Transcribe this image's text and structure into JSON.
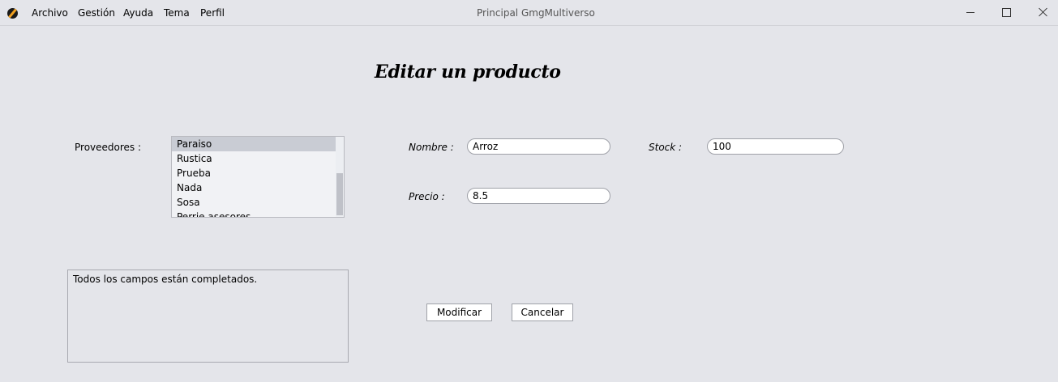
{
  "window": {
    "title": "Principal GmgMultiverso",
    "menu": [
      "Archivo",
      "Gestión",
      "Ayuda",
      "Tema",
      "Perfil"
    ]
  },
  "form": {
    "heading": "Editar un producto",
    "proveedores_label": "Proveedores :",
    "proveedores": [
      "Paraiso",
      "Rustica",
      "Prueba",
      "Nada",
      "Sosa",
      "Perrie asesores"
    ],
    "selected_proveedor": "Paraiso",
    "nombre_label": "Nombre :",
    "nombre_value": "Arroz",
    "stock_label": "Stock :",
    "stock_value": "100",
    "precio_label": "Precio :",
    "precio_value": "8.5",
    "message": "Todos los campos están completados.",
    "modificar_label": "Modificar",
    "cancelar_label": "Cancelar"
  },
  "colors": {
    "background": "#e4e5ea",
    "selection": "#c9ccd4",
    "app_icon_accent": "#f0a020"
  },
  "icons": {
    "app": "app-logo-icon",
    "minimize": "minimize-icon",
    "maximize": "maximize-icon",
    "close": "close-icon"
  }
}
